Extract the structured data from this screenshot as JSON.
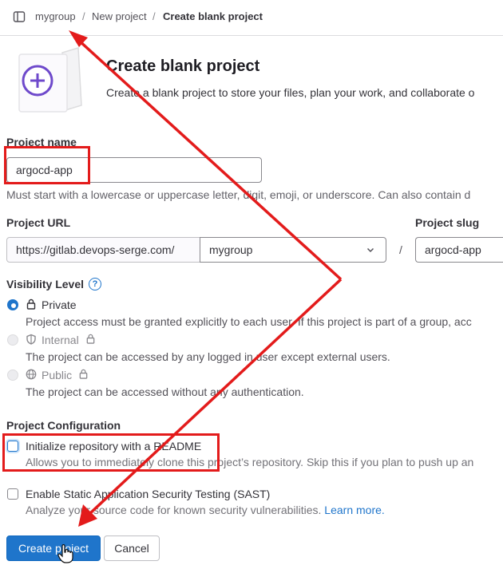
{
  "breadcrumb": {
    "items": [
      "mygroup",
      "New project",
      "Create blank project"
    ],
    "separator": "/"
  },
  "header": {
    "title": "Create blank project",
    "description": "Create a blank project to store your files, plan your work, and collaborate o"
  },
  "form": {
    "project_name": {
      "label": "Project name",
      "value": "argocd-app",
      "help": "Must start with a lowercase or uppercase letter, digit, emoji, or underscore. Can also contain d"
    },
    "project_url": {
      "label": "Project URL",
      "prefix": "https://gitlab.devops-serge.com/",
      "namespace": "mygroup",
      "slash": "/"
    },
    "project_slug": {
      "label": "Project slug",
      "value": "argocd-app"
    },
    "visibility": {
      "label": "Visibility Level",
      "help_icon": "?",
      "options": [
        {
          "label": "Private",
          "icon": "lock-icon",
          "checked": true,
          "disabled": false,
          "description": "Project access must be granted explicitly to each user. If this project is part of a group, acc"
        },
        {
          "label": "Internal",
          "icon": "shield-icon",
          "checked": false,
          "disabled": true,
          "description": "The project can be accessed by any logged in user except external users."
        },
        {
          "label": "Public",
          "icon": "globe-icon",
          "checked": false,
          "disabled": true,
          "description": "The project can be accessed without any authentication."
        }
      ]
    },
    "configuration": {
      "label": "Project Configuration",
      "readme": {
        "label": "Initialize repository with a README",
        "checked": false,
        "description": "Allows you to immediately clone this project’s repository. Skip this if you plan to push up an"
      },
      "sast": {
        "label": "Enable Static Application Security Testing (SAST)",
        "checked": false,
        "description": "Analyze your source code for known security vulnerabilities.",
        "link": "Learn more."
      }
    }
  },
  "actions": {
    "create": "Create project",
    "cancel": "Cancel"
  },
  "colors": {
    "accent": "#1f75cb",
    "annotation": "#e31b1b"
  }
}
